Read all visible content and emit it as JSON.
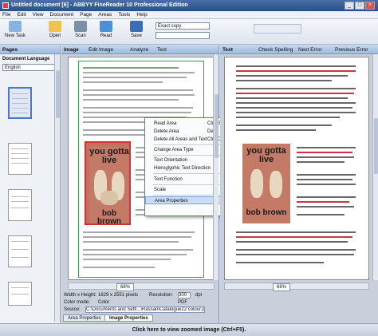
{
  "window": {
    "title": "Untitled document [6] - ABBYY FineReader 10 Professional Edition",
    "controls": [
      "_",
      "□",
      "×"
    ]
  },
  "menu": [
    "File",
    "Edit",
    "View",
    "Document",
    "Page",
    "Areas",
    "Tools",
    "Help"
  ],
  "toolbar": {
    "new_task": "New Task",
    "open": "Open",
    "scan": "Scan",
    "read": "Read",
    "save": "Save",
    "exact_copy": "Exact copy"
  },
  "pages_pane": {
    "title": "Pages",
    "doc_lang_label": "Document Language",
    "doc_lang_value": "English"
  },
  "image_pane": {
    "title": "Image",
    "edit_image": "Edit Image",
    "analyze": "Analyze",
    "text_btn": "Text",
    "zoom": "68%",
    "width_height_label": "Width x Height:",
    "width_height_value": "1629 x 2551 pixels",
    "resolution_label": "Resolution:",
    "resolution_value": "300",
    "resolution_unit": "dpi",
    "color_mode_label": "Color mode:",
    "color_mode_value": "Color",
    "format_value": "PDF",
    "source_label": "Source:",
    "source_value": "C:\\Documents and Setti...\\RassamCatalogue22 colour.pdf",
    "tab_area_props": "Area Properties",
    "tab_image_props": "Image Properties"
  },
  "book_cover": {
    "line1": "you gotta",
    "line2": "live",
    "line3": "bob brown"
  },
  "context_menu": {
    "read_area": "Read Area",
    "read_area_sc": "Ctrl+Shift+B",
    "delete_area": "Delete Area",
    "delete_area_sc": "Del",
    "delete_all": "Delete All Areas and Text",
    "delete_all_sc": "Ctrl+Del",
    "change_type": "Change Area Type",
    "text_orientation": "Text Orientation",
    "hieroglyphic": "Hieroglyphic Text Direction",
    "text_function": "Text Function",
    "scale": "Scale",
    "area_properties": "Area Properties"
  },
  "text_pane": {
    "title": "Text",
    "check_spelling": "Check Spelling",
    "next_error": "Next Error",
    "prev_error": "Previous Error",
    "zoom": "68%"
  },
  "status": "Click here to view zoomed image (Ctrl+F5)."
}
